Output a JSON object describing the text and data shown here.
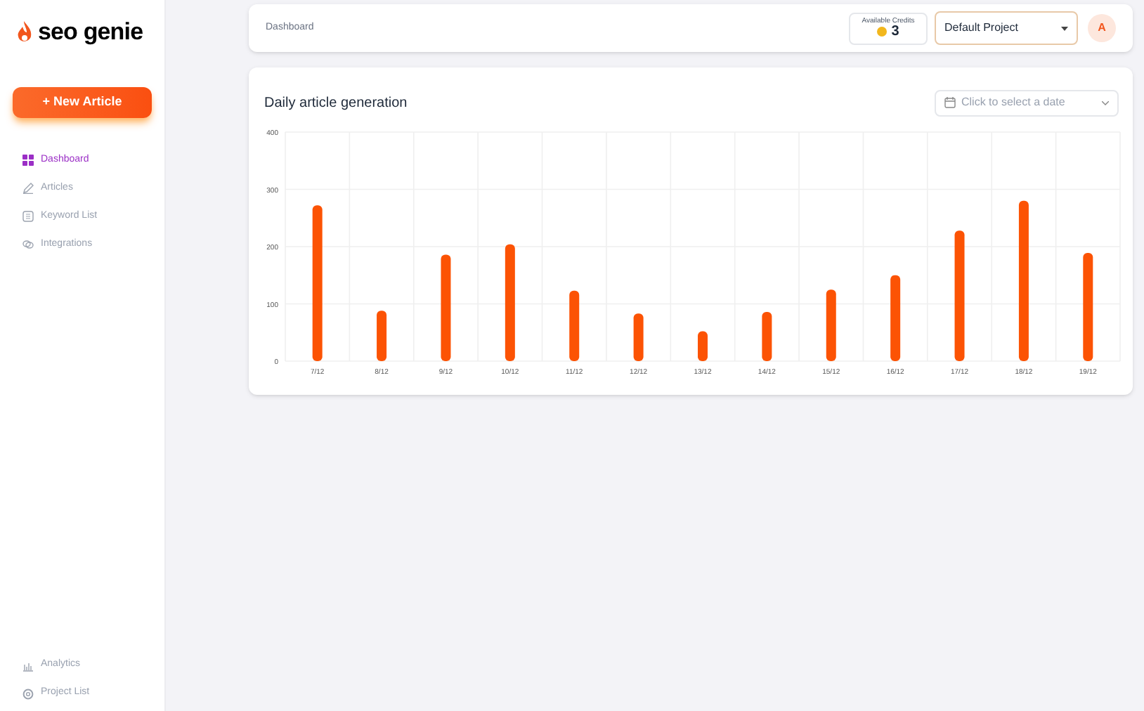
{
  "sidebar": {
    "logo": "seo genie",
    "new_button": "+ New Article",
    "items": [
      {
        "label": "Dashboard",
        "selected": true
      },
      {
        "label": "Articles",
        "selected": false
      },
      {
        "label": "Keyword List",
        "selected": false
      },
      {
        "label": "Integrations",
        "selected": false
      }
    ],
    "bottom_items": [
      {
        "label": "Analytics",
        "selected": false
      },
      {
        "label": "Project List",
        "selected": false
      }
    ]
  },
  "header": {
    "breadcrumb": "Dashboard",
    "credits_label": "Available Credits",
    "credits_value": "3",
    "project": "Default Project",
    "avatar": "A"
  },
  "chart_card": {
    "title": "Daily article generation",
    "date_placeholder": "Click to select a date",
    "chart_data": {
      "type": "bar",
      "categories": [
        "7/12",
        "8/12",
        "9/12",
        "10/12",
        "11/12",
        "12/12",
        "13/12",
        "14/12",
        "15/12",
        "16/12",
        "17/12",
        "18/12",
        "19/12"
      ],
      "grid": true,
      "series": [
        {
          "color": "#fc5304",
          "values": [
            272,
            88,
            186,
            204,
            123,
            83,
            52,
            86,
            125,
            150,
            228,
            280,
            189
          ]
        }
      ],
      "ylim": [
        0,
        400
      ],
      "yticks": [
        0,
        100,
        200,
        300,
        400
      ]
    }
  }
}
